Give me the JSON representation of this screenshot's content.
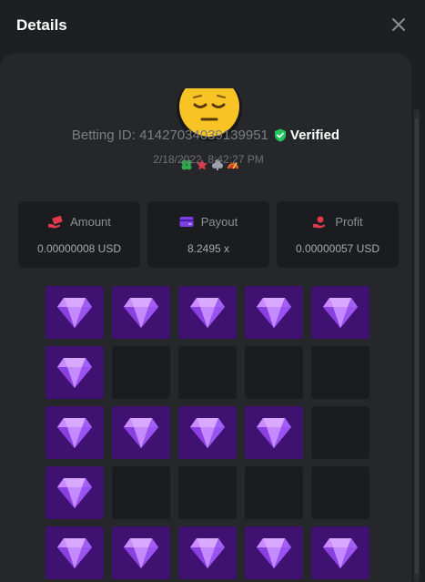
{
  "header": {
    "title": "Details"
  },
  "user": {
    "badges": [
      "clover-icon",
      "star-leaf-icon",
      "club-icon",
      "speedometer-icon"
    ],
    "betting_label": "Betting ID: 41427034039139951",
    "verified_label": "Verified",
    "date": "2/18/2022, 8:42:27 PM"
  },
  "stats": [
    {
      "label": "Amount",
      "value": "0.00000008 USD",
      "icon": "money-hand-icon"
    },
    {
      "label": "Payout",
      "value": "8.2495 x",
      "icon": "wallet-icon"
    },
    {
      "label": "Profit",
      "value": "0.00000057 USD",
      "icon": "coin-hand-icon"
    }
  ],
  "board": {
    "rows": [
      [
        "gem",
        "gem",
        "gem",
        "gem",
        "gem"
      ],
      [
        "gem",
        "empty",
        "empty",
        "empty",
        "empty"
      ],
      [
        "gem",
        "gem",
        "gem",
        "gem",
        "empty"
      ],
      [
        "gem",
        "empty",
        "empty",
        "empty",
        "empty"
      ],
      [
        "gem",
        "gem",
        "gem",
        "gem",
        "gem"
      ]
    ]
  },
  "colors": {
    "gem_tile": "#3f1272",
    "empty_tile": "#1b1c1f",
    "verified_green": "#22c55e",
    "accent_purple": "#7b3fe4",
    "accent_red": "#e0394b"
  }
}
